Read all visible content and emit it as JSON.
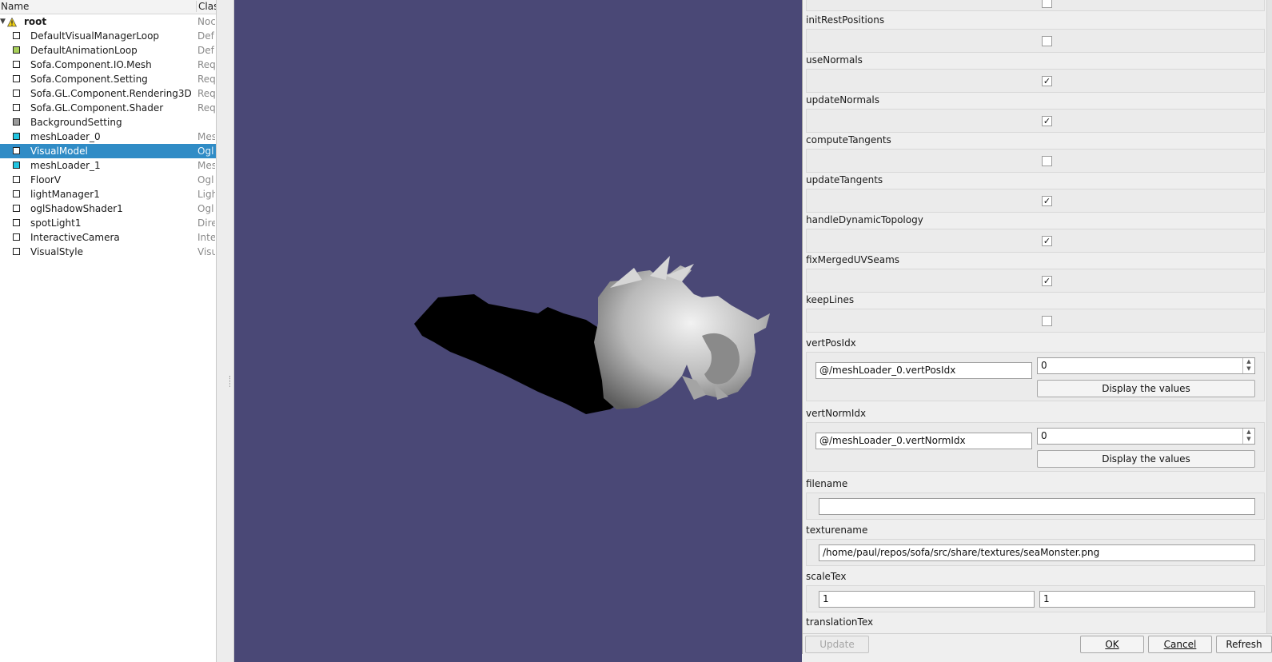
{
  "tree": {
    "headers": {
      "name": "Name",
      "class": "Clas"
    },
    "root": {
      "label": "root",
      "class": "Noc"
    },
    "nodes": [
      {
        "label": "DefaultVisualManagerLoop",
        "class": "Def",
        "color": "#ffffff",
        "selected": false
      },
      {
        "label": "DefaultAnimationLoop",
        "class": "Def",
        "color": "#a8d05a",
        "selected": false
      },
      {
        "label": "Sofa.Component.IO.Mesh",
        "class": "Req",
        "color": "#ffffff",
        "selected": false
      },
      {
        "label": "Sofa.Component.Setting",
        "class": "Req",
        "color": "#ffffff",
        "selected": false
      },
      {
        "label": "Sofa.GL.Component.Rendering3D",
        "class": "Req",
        "color": "#ffffff",
        "selected": false
      },
      {
        "label": "Sofa.GL.Component.Shader",
        "class": "Req",
        "color": "#ffffff",
        "selected": false
      },
      {
        "label": "BackgroundSetting",
        "class": "",
        "color": "#9a9a9a",
        "selected": false
      },
      {
        "label": "meshLoader_0",
        "class": "Mes",
        "color": "#22c4e0",
        "selected": false
      },
      {
        "label": "VisualModel",
        "class": "Ogl",
        "color": "#ffffff",
        "selected": true
      },
      {
        "label": "meshLoader_1",
        "class": "Mes",
        "color": "#22c4e0",
        "selected": false
      },
      {
        "label": "FloorV",
        "class": "Ogl",
        "color": "#ffffff",
        "selected": false
      },
      {
        "label": "lightManager1",
        "class": "Ligh",
        "color": "#ffffff",
        "selected": false
      },
      {
        "label": "oglShadowShader1",
        "class": "Ogl",
        "color": "#ffffff",
        "selected": false
      },
      {
        "label": "spotLight1",
        "class": "Dire",
        "color": "#ffffff",
        "selected": false
      },
      {
        "label": "InteractiveCamera",
        "class": "Inte",
        "color": "#ffffff",
        "selected": false
      },
      {
        "label": "VisualStyle",
        "class": "Visu",
        "color": "#ffffff",
        "selected": false
      }
    ]
  },
  "viewport": {
    "background": "#4a4876"
  },
  "props": {
    "checks": [
      {
        "label": "initRestPositions",
        "checked": false
      },
      {
        "label": "useNormals",
        "checked": true
      },
      {
        "label": "updateNormals",
        "checked": true
      },
      {
        "label": "computeTangents",
        "checked": false
      },
      {
        "label": "updateTangents",
        "checked": true
      },
      {
        "label": "handleDynamicTopology",
        "checked": true
      },
      {
        "label": "fixMergedUVSeams",
        "checked": true
      },
      {
        "label": "keepLines",
        "checked": false
      }
    ],
    "vertPosIdx": {
      "label": "vertPosIdx",
      "link": "@/meshLoader_0.vertPosIdx",
      "count": "0",
      "button": "Display the values"
    },
    "vertNormIdx": {
      "label": "vertNormIdx",
      "link": "@/meshLoader_0.vertNormIdx",
      "count": "0",
      "button": "Display the values"
    },
    "filename": {
      "label": "filename",
      "value": ""
    },
    "texturename": {
      "label": "texturename",
      "value": "/home/paul/repos/sofa/src/share/textures/seaMonster.png"
    },
    "scaleTex": {
      "label": "scaleTex",
      "x": "1",
      "y": "1"
    },
    "translationTex": {
      "label": "translationTex"
    }
  },
  "buttons": {
    "update": "Update",
    "ok": "OK",
    "cancel": "Cancel",
    "refresh": "Refresh"
  }
}
